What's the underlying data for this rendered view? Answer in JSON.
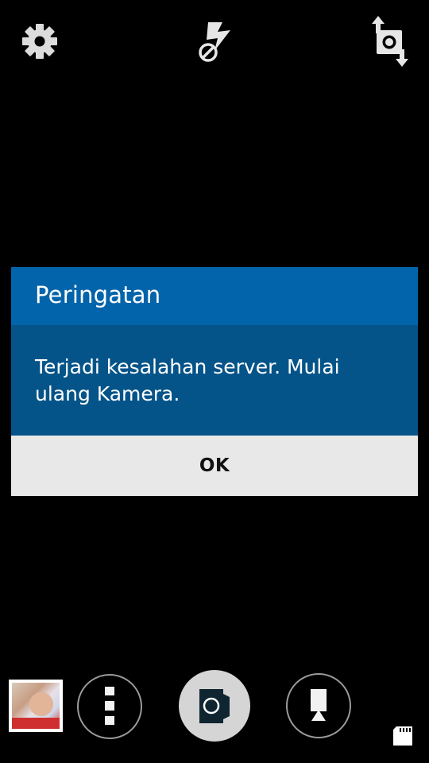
{
  "camera_controls": {
    "settings_icon": "gear-icon",
    "flash_icon": "flash-off-icon",
    "switch_camera_icon": "switch-camera-icon"
  },
  "dialog": {
    "title": "Peringatan",
    "message": "Terjadi kesalahan server. Mulai ulang Kamera.",
    "ok_label": "OK",
    "title_bar_color": "#0264aa",
    "body_color": "#045489",
    "footer_color": "#e8e8e8"
  },
  "bottom_bar": {
    "gallery_thumbnail_icon": "gallery-thumbnail",
    "mode_menu_icon": "more-options-icon",
    "shutter_icon": "camera-icon",
    "record_icon": "video-record-icon",
    "storage_icon": "sd-card-icon"
  }
}
